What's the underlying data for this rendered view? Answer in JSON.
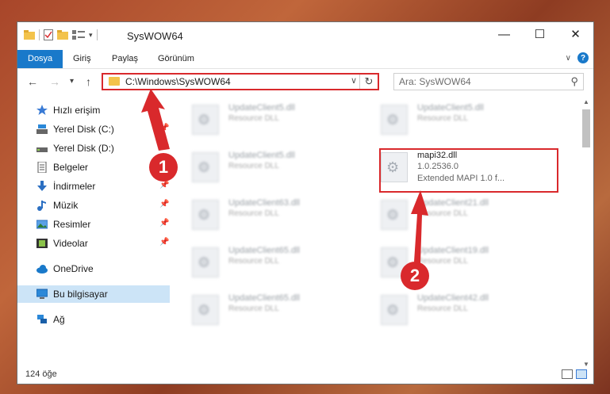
{
  "window": {
    "title": "SysWOW64"
  },
  "ribbon": {
    "tabs": [
      "Dosya",
      "Giriş",
      "Paylaş",
      "Görünüm"
    ]
  },
  "address": {
    "path": "C:\\Windows\\SysWOW64"
  },
  "search": {
    "placeholder": "Ara: SysWOW64"
  },
  "sidebar": {
    "items": [
      {
        "label": "Hızlı erişim",
        "icon": "star-icon"
      },
      {
        "label": "Yerel Disk (C:)",
        "icon": "drive-icon"
      },
      {
        "label": "Yerel Disk (D:)",
        "icon": "drive-icon"
      },
      {
        "label": "Belgeler",
        "icon": "documents-icon"
      },
      {
        "label": "İndirmeler",
        "icon": "download-icon"
      },
      {
        "label": "Müzik",
        "icon": "music-icon"
      },
      {
        "label": "Resimler",
        "icon": "pictures-icon"
      },
      {
        "label": "Videolar",
        "icon": "video-icon"
      },
      {
        "label": "OneDrive",
        "icon": "cloud-icon"
      },
      {
        "label": "Bu bilgisayar",
        "icon": "computer-icon"
      },
      {
        "label": "Ağ",
        "icon": "network-icon"
      }
    ]
  },
  "files": {
    "left": [
      {
        "name": "UpdateClient5.dll",
        "type": "Resource DLL"
      },
      {
        "name": "UpdateClient5.dll",
        "type": "Resource DLL"
      },
      {
        "name": "UpdateClient63.dll",
        "type": "Resource DLL"
      },
      {
        "name": "UpdateClient65.dll",
        "type": "Resource DLL"
      },
      {
        "name": "UpdateClient65.dll",
        "type": "Resource DLL"
      }
    ],
    "right": [
      {
        "name": "UpdateClient5.dll",
        "type": "Resource DLL"
      },
      {
        "name": "UpdateClient21.dll",
        "type": "Resource DLL"
      },
      {
        "name": "UpdateClient19.dll",
        "type": "Resource DLL"
      },
      {
        "name": "UpdateClient19.dll",
        "type": "Resource DLL"
      },
      {
        "name": "UpdateClient42.dll",
        "type": "Resource DLL"
      }
    ],
    "highlighted": {
      "name": "mapi32.dll",
      "version": "1.0.2536.0",
      "description": "Extended MAPI 1.0 f..."
    }
  },
  "status": {
    "count": "124 öğe"
  },
  "badges": [
    "1",
    "2"
  ],
  "colors": {
    "accent": "#1979ca",
    "highlight": "#d9292c"
  }
}
